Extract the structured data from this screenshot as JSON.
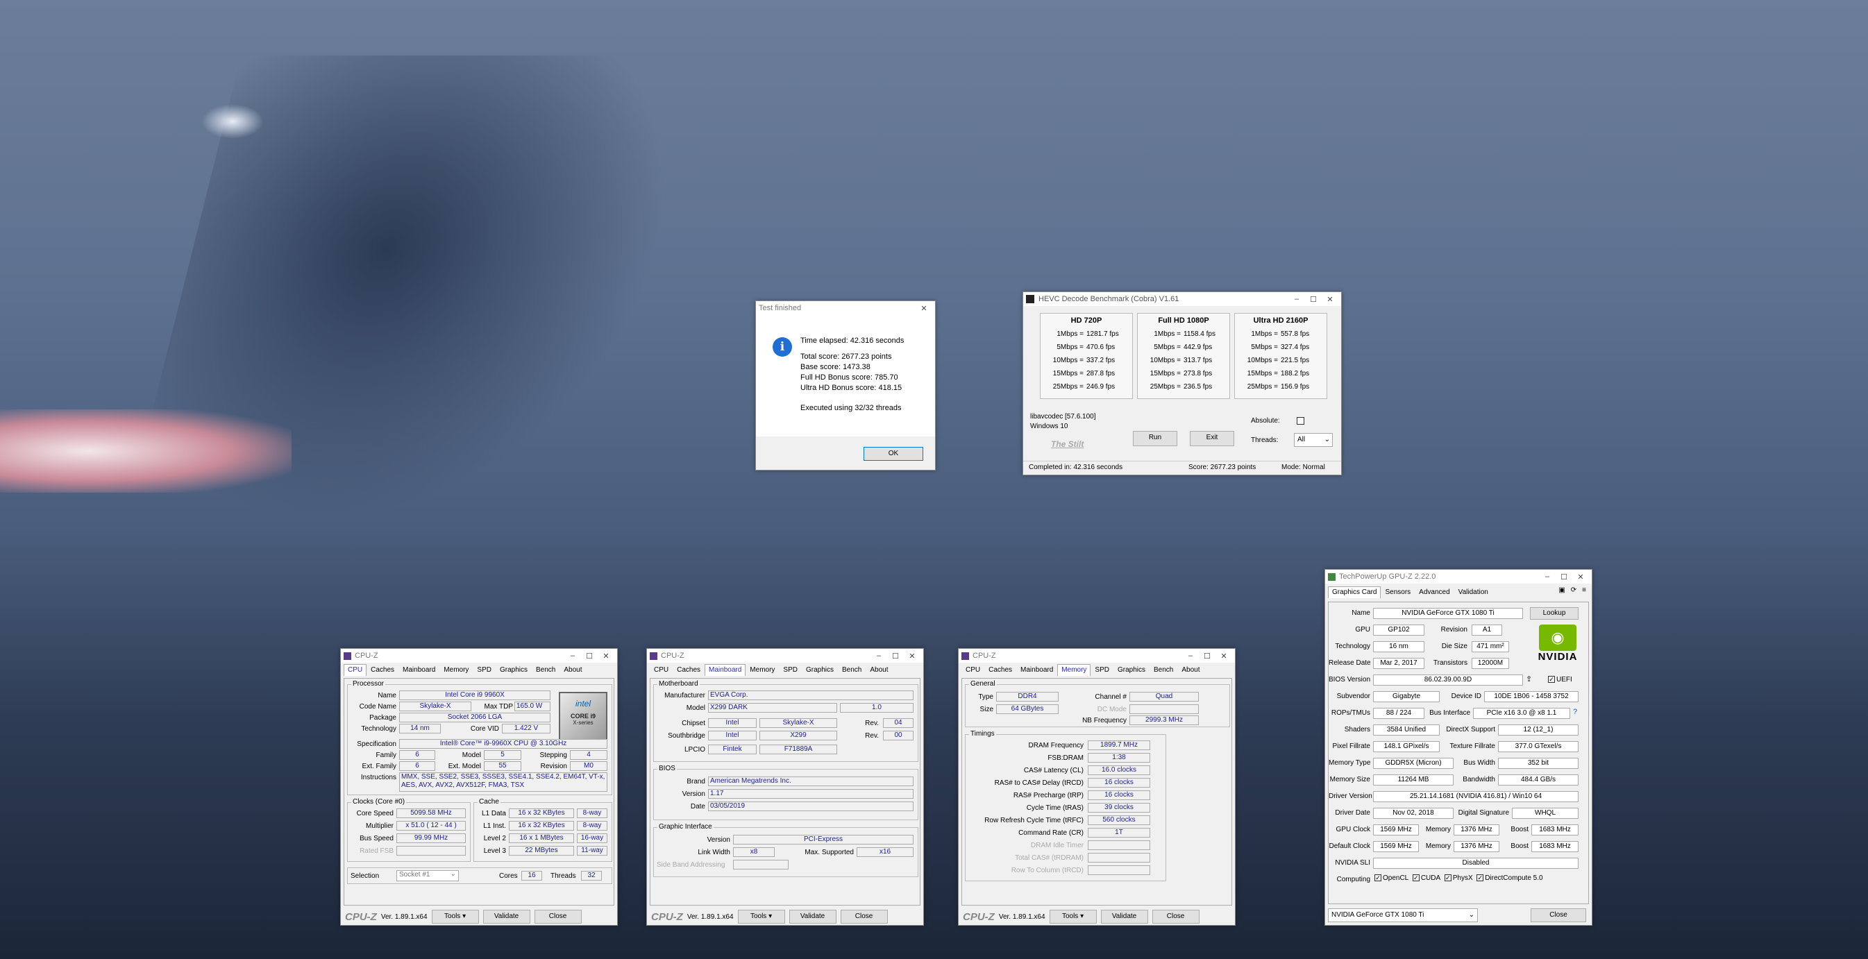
{
  "dialog": {
    "title": "Test finished",
    "lines": [
      "Time elapsed:  42.316 seconds",
      "Total score:  2677.23 points",
      "Base score: 1473.38",
      "Full HD Bonus score: 785.70",
      "Ultra HD Bonus score: 418.15",
      "Executed using 32/32 threads"
    ],
    "ok_label": "OK"
  },
  "hevc": {
    "title": "HEVC Decode Benchmark (Cobra) V1.61",
    "columns": [
      {
        "header": "HD 720P",
        "rows": [
          [
            "1Mbps =",
            "1281.7 fps"
          ],
          [
            "5Mbps =",
            "470.6 fps"
          ],
          [
            "10Mbps =",
            "337.2 fps"
          ],
          [
            "15Mbps =",
            "287.8 fps"
          ],
          [
            "25Mbps =",
            "246.9 fps"
          ]
        ]
      },
      {
        "header": "Full HD 1080P",
        "rows": [
          [
            "1Mbps =",
            "1158.4 fps"
          ],
          [
            "5Mbps =",
            "442.9 fps"
          ],
          [
            "10Mbps =",
            "313.7 fps"
          ],
          [
            "15Mbps =",
            "273.8 fps"
          ],
          [
            "25Mbps =",
            "236.5 fps"
          ]
        ]
      },
      {
        "header": "Ultra HD 2160P",
        "rows": [
          [
            "1Mbps =",
            "557.8 fps"
          ],
          [
            "5Mbps =",
            "327.4 fps"
          ],
          [
            "10Mbps =",
            "221.5 fps"
          ],
          [
            "15Mbps =",
            "188.2 fps"
          ],
          [
            "25Mbps =",
            "156.9 fps"
          ]
        ]
      }
    ],
    "lib": "libavcodec [57.6.100]",
    "os": "Windows 10",
    "brand": "The Stilt",
    "run_label": "Run",
    "exit_label": "Exit",
    "absolute_label": "Absolute:",
    "threads_label": "Threads:",
    "threads_value": "All",
    "status_completed": "Completed in: 42.316 seconds",
    "status_score": "Score: 2677.23 points",
    "status_mode": "Mode: Normal"
  },
  "cpuz_common": {
    "title": "CPU-Z",
    "tabs": [
      "CPU",
      "Caches",
      "Mainboard",
      "Memory",
      "SPD",
      "Graphics",
      "Bench",
      "About"
    ],
    "logo": "CPU-Z",
    "version": "Ver. 1.89.1.x64",
    "tools": "Tools",
    "validate": "Validate",
    "close": "Close"
  },
  "cpuz1": {
    "processor_legend": "Processor",
    "name_l": "Name",
    "name": "Intel Core i9 9960X",
    "code_l": "Code Name",
    "code": "Skylake-X",
    "tdp_l": "Max TDP",
    "tdp": "165.0 W",
    "pkg_l": "Package",
    "pkg": "Socket 2066 LGA",
    "tech_l": "Technology",
    "tech": "14 nm",
    "vid_l": "Core VID",
    "vid": "1.422 V",
    "spec_l": "Specification",
    "spec": "Intel® Core™ i9-9960X CPU @ 3.10GHz",
    "fam_l": "Family",
    "fam": "6",
    "model_l": "Model",
    "model": "5",
    "step_l": "Stepping",
    "step": "4",
    "efam_l": "Ext. Family",
    "efam": "6",
    "emodel_l": "Ext. Model",
    "emodel": "55",
    "rev_l": "Revision",
    "rev": "M0",
    "instr_l": "Instructions",
    "instr": "MMX, SSE, SSE2, SSE3, SSSE3, SSE4.1, SSE4.2, EM64T, VT-x, AES, AVX, AVX2, AVX512F, FMA3, TSX",
    "clocks_legend": "Clocks (Core #0)",
    "cs_l": "Core Speed",
    "cs": "5099.58 MHz",
    "mul_l": "Multiplier",
    "mul": "x 51.0 ( 12 - 44 )",
    "bus_l": "Bus Speed",
    "bus": "99.99 MHz",
    "fsb_l": "Rated FSB",
    "cache_legend": "Cache",
    "l1d_l": "L1 Data",
    "l1d": "16 x 32 KBytes",
    "l1d_w": "8-way",
    "l1i_l": "L1 Inst.",
    "l1i": "16 x 32 KBytes",
    "l1i_w": "8-way",
    "l2_l": "Level 2",
    "l2": "16 x 1 MBytes",
    "l2_w": "16-way",
    "l3_l": "Level 3",
    "l3": "22 MBytes",
    "l3_w": "11-way",
    "sel_l": "Selection",
    "sel": "Socket #1",
    "cores_l": "Cores",
    "cores": "16",
    "threads_l": "Threads",
    "threads": "32",
    "badge_brand": "intel",
    "badge_line1": "CORE i9",
    "badge_line2": "X-series"
  },
  "cpuz2": {
    "mb_legend": "Motherboard",
    "man_l": "Manufacturer",
    "man": "EVGA Corp.",
    "model_l": "Model",
    "model": "X299 DARK",
    "model_rev": "1.0",
    "chip_l": "Chipset",
    "chip": "Intel",
    "chip2": "Skylake-X",
    "chip_rev_l": "Rev.",
    "chip_rev": "04",
    "sb_l": "Southbridge",
    "sb": "Intel",
    "sb2": "X299",
    "sb_rev_l": "Rev.",
    "sb_rev": "00",
    "lpc_l": "LPCIO",
    "lpc": "Fintek",
    "lpc2": "F71889A",
    "bios_legend": "BIOS",
    "brand_l": "Brand",
    "brand": "American Megatrends Inc.",
    "ver_l": "Version",
    "ver": "1.17",
    "date_l": "Date",
    "date": "03/05/2019",
    "gi_legend": "Graphic Interface",
    "gver_l": "Version",
    "gver": "PCI-Express",
    "lw_l": "Link Width",
    "lw": "x8",
    "ms_l": "Max. Supported",
    "ms": "x16",
    "sba_l": "Side Band Addressing"
  },
  "cpuz3": {
    "gen_legend": "General",
    "type_l": "Type",
    "type": "DDR4",
    "ch_l": "Channel #",
    "ch": "Quad",
    "size_l": "Size",
    "size": "64 GBytes",
    "dc_l": "DC Mode",
    "nb_l": "NB Frequency",
    "nb": "2999.3 MHz",
    "tim_legend": "Timings",
    "rows": [
      {
        "l": "DRAM Frequency",
        "v": "1899.7 MHz",
        "dis": false
      },
      {
        "l": "FSB:DRAM",
        "v": "1:38",
        "dis": false
      },
      {
        "l": "CAS# Latency (CL)",
        "v": "16.0 clocks",
        "dis": false
      },
      {
        "l": "RAS# to CAS# Delay (tRCD)",
        "v": "16 clocks",
        "dis": false
      },
      {
        "l": "RAS# Precharge (tRP)",
        "v": "16 clocks",
        "dis": false
      },
      {
        "l": "Cycle Time (tRAS)",
        "v": "39 clocks",
        "dis": false
      },
      {
        "l": "Row Refresh Cycle Time (tRFC)",
        "v": "560 clocks",
        "dis": false
      },
      {
        "l": "Command Rate (CR)",
        "v": "1T",
        "dis": false
      },
      {
        "l": "DRAM Idle Timer",
        "v": "",
        "dis": true
      },
      {
        "l": "Total CAS# (tRDRAM)",
        "v": "",
        "dis": true
      },
      {
        "l": "Row To Column (tRCD)",
        "v": "",
        "dis": true
      }
    ]
  },
  "gpuz": {
    "title": "TechPowerUp GPU-Z 2.22.0",
    "tabs": [
      "Graphics Card",
      "Sensors",
      "Advanced",
      "Validation"
    ],
    "name_l": "Name",
    "name": "NVIDIA GeForce GTX 1080 Ti",
    "lookup": "Lookup",
    "gpu_l": "GPU",
    "gpu": "GP102",
    "rev_l": "Revision",
    "rev": "A1",
    "tech_l": "Technology",
    "tech": "16 nm",
    "die_l": "Die Size",
    "die": "471 mm²",
    "rd_l": "Release Date",
    "rd": "Mar 2, 2017",
    "tr_l": "Transistors",
    "tr": "12000M",
    "bios_l": "BIOS Version",
    "bios": "86.02.39.00.9D",
    "uefi": "UEFI",
    "sub_l": "Subvendor",
    "sub": "Gigabyte",
    "did_l": "Device ID",
    "did": "10DE 1B06 - 1458 3752",
    "rops_l": "ROPs/TMUs",
    "rops": "88 / 224",
    "bi_l": "Bus Interface",
    "bi": "PCIe x16 3.0 @ x8 1.1",
    "sh_l": "Shaders",
    "sh": "3584 Unified",
    "dx_l": "DirectX Support",
    "dx": "12 (12_1)",
    "pf_l": "Pixel Fillrate",
    "pf": "148.1 GPixel/s",
    "tf_l": "Texture Fillrate",
    "tf": "377.0 GTexel/s",
    "mt_l": "Memory Type",
    "mt": "GDDR5X (Micron)",
    "bw_l": "Bus Width",
    "bw": "352 bit",
    "ms_l": "Memory Size",
    "ms": "11264 MB",
    "bandw_l": "Bandwidth",
    "bandw": "484.4 GB/s",
    "dv_l": "Driver Version",
    "dv": "25.21.14.1681 (NVIDIA 416.81) / Win10 64",
    "dd_l": "Driver Date",
    "dd": "Nov 02, 2018",
    "ds_l": "Digital Signature",
    "ds": "WHQL",
    "gc_l": "GPU Clock",
    "gc": "1569 MHz",
    "mem_l": "Memory",
    "mem": "1376 MHz",
    "boost_l": "Boost",
    "boost": "1683 MHz",
    "dc_l": "Default Clock",
    "dc": "1569 MHz",
    "mem2": "1376 MHz",
    "boost2": "1683 MHz",
    "sli_l": "NVIDIA SLI",
    "sli": "Disabled",
    "comp_l": "Computing",
    "c1": "OpenCL",
    "c2": "CUDA",
    "c3": "PhysX",
    "c4": "DirectCompute 5.0",
    "select": "NVIDIA GeForce GTX 1080 Ti",
    "close": "Close",
    "nvidia": "NVIDIA"
  }
}
